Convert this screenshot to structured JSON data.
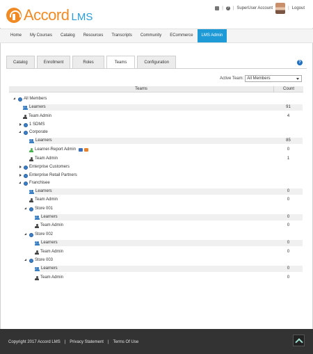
{
  "header": {
    "logo_word": "Accord",
    "logo_suffix": "LMS",
    "account_label": "SuperUser Account",
    "logout_label": "Logout",
    "sep": "|"
  },
  "nav": {
    "items": [
      "Home",
      "My Courses",
      "Catalog",
      "Resources",
      "Transcripts",
      "Community",
      "ECommerce",
      "LMS Admin"
    ],
    "active": "LMS Admin"
  },
  "tabs": {
    "items": [
      "Catalog",
      "Enrollment",
      "Roles",
      "Teams",
      "Configuration"
    ],
    "active": "Teams"
  },
  "filter": {
    "label": "Active Team:",
    "value": "All Members"
  },
  "table": {
    "col_teams": "Teams",
    "col_count": "Count",
    "rows": [
      {
        "label": "All Members",
        "icon": "globe-icon",
        "toggle": "expanded",
        "count": ""
      },
      {
        "label": "Learners",
        "icon": "learners-icon",
        "toggle": "none",
        "count": "91"
      },
      {
        "label": "Team Admin",
        "icon": "admin-icon",
        "toggle": "none",
        "count": "4"
      },
      {
        "label": "1 SDMS",
        "icon": "globe-icon",
        "toggle": "collapsed",
        "count": ""
      },
      {
        "label": "Corporate",
        "icon": "globe-icon",
        "toggle": "expanded",
        "count": ""
      },
      {
        "label": "Learners",
        "icon": "learners-icon",
        "toggle": "none",
        "count": "85"
      },
      {
        "label": "Learner-Report Admin",
        "icon": "report-admin-icon",
        "toggle": "none",
        "count": "0"
      },
      {
        "label": "Team Admin",
        "icon": "admin-icon",
        "toggle": "none",
        "count": "1"
      },
      {
        "label": "Enterprise Customers",
        "icon": "globe-icon",
        "toggle": "collapsed",
        "count": ""
      },
      {
        "label": "Enterprise Retail Partners",
        "icon": "globe-icon",
        "toggle": "collapsed",
        "count": ""
      },
      {
        "label": "Franchisee",
        "icon": "globe-icon",
        "toggle": "expanded",
        "count": ""
      },
      {
        "label": "Learners",
        "icon": "learners-icon",
        "toggle": "none",
        "count": "0"
      },
      {
        "label": "Team Admin",
        "icon": "admin-icon",
        "toggle": "none",
        "count": "0"
      },
      {
        "label": "Store 001",
        "icon": "globe-icon",
        "toggle": "expanded",
        "count": ""
      },
      {
        "label": "Learners",
        "icon": "learners-icon",
        "toggle": "none",
        "count": "0"
      },
      {
        "label": "Team Admin",
        "icon": "admin-icon",
        "toggle": "none",
        "count": "0"
      },
      {
        "label": "Store 002",
        "icon": "globe-icon",
        "toggle": "expanded",
        "count": ""
      },
      {
        "label": "Learners",
        "icon": "learners-icon",
        "toggle": "none",
        "count": "0"
      },
      {
        "label": "Team Admin",
        "icon": "admin-icon",
        "toggle": "none",
        "count": "0"
      },
      {
        "label": "Store 003",
        "icon": "globe-icon",
        "toggle": "expanded",
        "count": ""
      },
      {
        "label": "Learners",
        "icon": "learners-icon",
        "toggle": "none",
        "count": "0"
      },
      {
        "label": "Team Admin",
        "icon": "admin-icon",
        "toggle": "none",
        "count": "0"
      }
    ]
  },
  "footer": {
    "copyright": "Copyright 2017 Accord LMS",
    "privacy": "Privacy Statement",
    "terms": "Terms Of Use",
    "sep": "|"
  },
  "colors": {
    "brand_orange": "#f08a24",
    "brand_blue": "#1e9ad6",
    "footer_bg": "#333333"
  }
}
